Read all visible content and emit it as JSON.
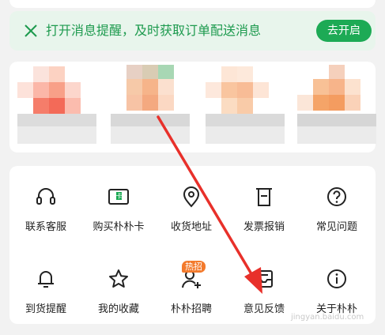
{
  "notification": {
    "text": "打开消息提醒，及时获取订单配送消息",
    "button": "去开启",
    "accent": "#1daa55"
  },
  "services": {
    "items": [
      {
        "label": "联系客服",
        "icon": "headset-icon"
      },
      {
        "label": "购买朴朴卡",
        "icon": "gift-card-icon"
      },
      {
        "label": "收货地址",
        "icon": "location-pin-icon"
      },
      {
        "label": "发票报销",
        "icon": "invoice-icon"
      },
      {
        "label": "常见问题",
        "icon": "question-icon"
      },
      {
        "label": "到货提醒",
        "icon": "bell-icon"
      },
      {
        "label": "我的收藏",
        "icon": "star-icon"
      },
      {
        "label": "朴朴招聘",
        "icon": "recruit-icon",
        "badge": "热招"
      },
      {
        "label": "意见反馈",
        "icon": "feedback-icon"
      },
      {
        "label": "关于朴朴",
        "icon": "info-icon"
      }
    ]
  },
  "watermark": "jingyan.baidu.com",
  "annotation_color": "#e8302a"
}
